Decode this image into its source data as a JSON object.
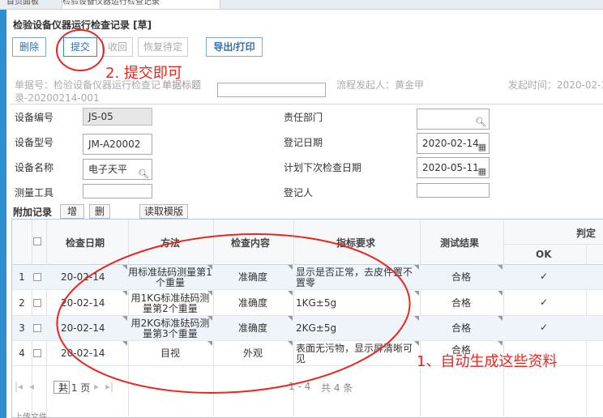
{
  "tabs": [
    {
      "label": "首页面板"
    },
    {
      "label": "检验设备仪器运行检查记录"
    }
  ],
  "page_title": "检验设备仪器运行检查记录 [草]",
  "toolbar": {
    "delete": "删除",
    "submit": "提交",
    "back": "收回",
    "restore": "恢复待定",
    "export": "导出/打印"
  },
  "header": {
    "doc_no_line1": "单据号：检验设备仪器运行检查记",
    "doc_no_line2": "录-20200214-001",
    "doc_title_label": "单据标题",
    "initiator": "流程发起人：黄金甲",
    "start_time": "发起时间：2020-02-1"
  },
  "form": {
    "device_no_label": "设备编号",
    "device_no": "JS-05",
    "dept_label": "责任部门",
    "dept": "",
    "model_label": "设备型号",
    "model": "JM-A20002",
    "reg_date_label": "登记日期",
    "reg_date": "2020-02-14",
    "name_label": "设备名称",
    "name": "电子天平",
    "next_date_label": "计划下次检查日期",
    "next_date": "2020-05-11",
    "tool_label": "测量工具",
    "registrar_label": "登记人",
    "registrar": ""
  },
  "subtable": {
    "title": "附加记录",
    "add": "增",
    "delete": "删",
    "template": "读取模版",
    "headers": {
      "date": "检查日期",
      "method": "方法",
      "content": "检查内容",
      "requirement": "指标要求",
      "result": "测试结果",
      "judge": "判定",
      "ok": "OK"
    },
    "rows": [
      {
        "no": "1",
        "date": "20-02-14",
        "method": "用标准砝码测量第1个重量",
        "content": "准确度",
        "requirement": "显示是否正常，去皮件置不置零",
        "result": "合格",
        "ok": "✓"
      },
      {
        "no": "2",
        "date": "20-02-14",
        "method": "用1KG标准砝码测量第2个重量",
        "content": "准确度",
        "requirement": "1KG±5g",
        "result": "合格",
        "ok": "✓"
      },
      {
        "no": "3",
        "date": "20-02-14",
        "method": "用2KG标准砝码测量第3个重量",
        "content": "准确度",
        "requirement": "2KG±5g",
        "result": "合格",
        "ok": "✓"
      },
      {
        "no": "4",
        "date": "20-02-14",
        "method": "目视",
        "content": "外观",
        "requirement": "表面无污物，显示屏清晰可见",
        "result": "合格",
        "ok": ""
      }
    ],
    "pager": {
      "page": "1",
      "total_pages": "共 1 页",
      "range": "1 - 4",
      "total_rows": "共 4 条"
    }
  },
  "bottom_note": "上传文件",
  "annotations": {
    "submit_note": "2. 提交即可",
    "auto_note": "1、自动生成这些资料"
  },
  "colors": {
    "accent": "#2d6fb0",
    "annotation": "#e8261f",
    "ok_check": "#36a83a"
  }
}
